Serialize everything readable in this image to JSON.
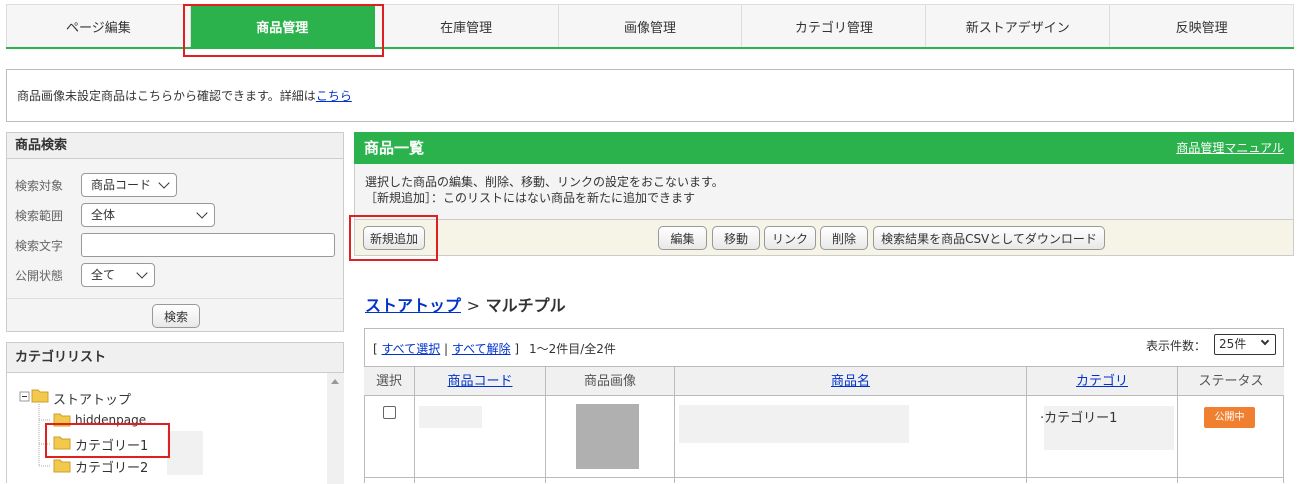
{
  "tabs": [
    {
      "label": "ページ編集",
      "active": false
    },
    {
      "label": "商品管理",
      "active": true
    },
    {
      "label": "在庫管理",
      "active": false
    },
    {
      "label": "画像管理",
      "active": false
    },
    {
      "label": "カテゴリ管理",
      "active": false
    },
    {
      "label": "新ストアデザイン",
      "active": false
    },
    {
      "label": "反映管理",
      "active": false
    }
  ],
  "notice": {
    "text": "商品画像未設定商品はこちらから確認できます。詳細は",
    "link": "こちら"
  },
  "search": {
    "title": "商品検索",
    "target_label": "検索対象",
    "target_value": "商品コード",
    "range_label": "検索範囲",
    "range_value": "全体",
    "keyword_label": "検索文字",
    "keyword_value": "",
    "status_label": "公開状態",
    "status_value": "全て",
    "search_button": "検索"
  },
  "category_list": {
    "title": "カテゴリリスト",
    "root": "ストアトップ",
    "items": [
      "hiddenpage",
      "カテゴリー1",
      "カテゴリー2"
    ]
  },
  "main": {
    "title": "商品一覧",
    "manual_link": "商品管理マニュアル",
    "desc_line1": "選択した商品の編集、削除、移動、リンクの設定をおこないます。",
    "desc_line2": "［新規追加］：このリストにはない商品を新たに追加できます",
    "new_button": "新規追加",
    "edit_button": "編集",
    "move_button": "移動",
    "link_button": "リンク",
    "delete_button": "削除",
    "csv_button": "検索結果を商品CSVとしてダウンロード",
    "breadcrumb_root": "ストアトップ",
    "breadcrumb_sep": ">",
    "breadcrumb_current": "マルチプル",
    "select_all": "すべて選択",
    "deselect_all": "すべて解除",
    "bracket_open": "[",
    "bracket_sep": "|",
    "bracket_close": "]",
    "count_text": "1〜2件目/全2件",
    "per_page_label": "表示件数：",
    "per_page_value": "25件"
  },
  "table": {
    "headers": [
      "選択",
      "商品コード",
      "商品画像",
      "商品名",
      "カテゴリ",
      "ステータス"
    ],
    "rows": [
      {
        "category": "カテゴリー1",
        "status": "公開中",
        "status_color": "#f08030"
      }
    ]
  }
}
